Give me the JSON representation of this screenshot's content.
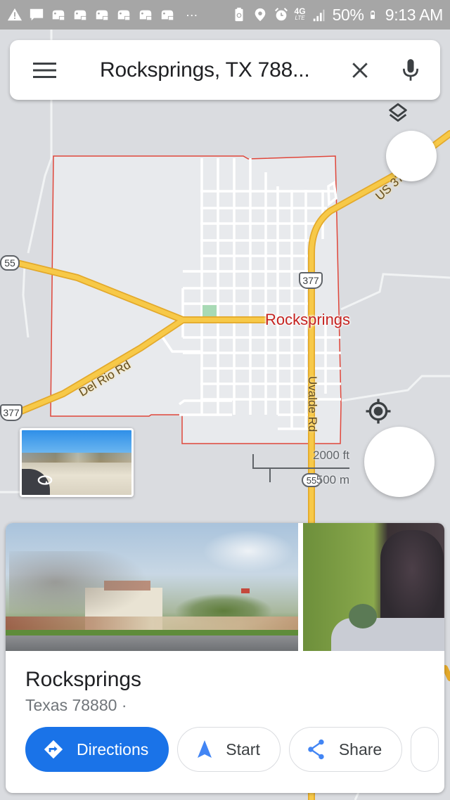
{
  "status_bar": {
    "left_icons": [
      "warning-icon",
      "message-icon",
      "game-controller-icon",
      "game-controller-icon",
      "game-controller-icon",
      "game-controller-icon",
      "game-controller-icon",
      "game-controller-icon",
      "more-dots-icon"
    ],
    "more": "···",
    "right_icons": [
      "battery-saver-icon",
      "location-icon",
      "alarm-icon",
      "4g-lte-icon",
      "signal-icon"
    ],
    "network": "4G",
    "network_sub": "LTE",
    "battery": "50%",
    "time": "9:13 AM"
  },
  "search": {
    "query": "Rocksprings, TX 788..."
  },
  "map": {
    "place_label": "Rocksprings",
    "roads": {
      "del_rio": "Del Rio Rd",
      "uvalde": "Uvalde Rd",
      "us377_top": "US 377"
    },
    "shields": {
      "route55": "55",
      "us377_left": "377",
      "us377_center": "377",
      "route55_bottom": "55"
    },
    "scale": {
      "imperial": "2000 ft",
      "metric": "500 m"
    },
    "colors": {
      "boundary": "#e0463a",
      "highway": "#f7c948",
      "highway_edge": "#e3a92b",
      "background": "#dadce0",
      "city_fill": "#e8eaed"
    }
  },
  "place_card": {
    "title": "Rocksprings",
    "subtitle": "Texas 78880 ·",
    "actions": [
      {
        "label": "Directions",
        "icon": "directions-icon"
      },
      {
        "label": "Start",
        "icon": "navigation-arrow-icon"
      },
      {
        "label": "Share",
        "icon": "share-icon"
      }
    ]
  },
  "accent_color": "#1a73e8"
}
